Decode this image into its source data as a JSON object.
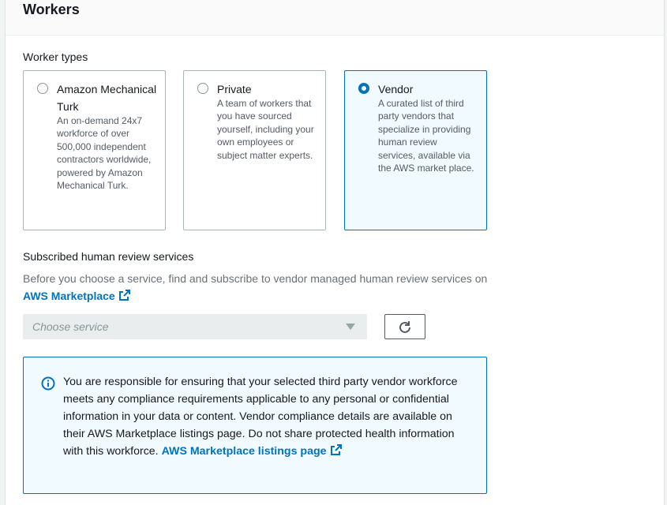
{
  "section": {
    "title": "Workers"
  },
  "worker_types": {
    "label": "Worker types",
    "selected": "vendor",
    "options": [
      {
        "id": "mturk",
        "title": "Amazon Mechanical Turk",
        "description": "An on-demand 24x7 workforce of over 500,000 independent contractors worldwide, powered by Amazon Mechanical Turk."
      },
      {
        "id": "private",
        "title": "Private",
        "description": "A team of workers that you have sourced yourself, including your own employees or subject matter experts."
      },
      {
        "id": "vendor",
        "title": "Vendor",
        "description": "A curated list of third party vendors that specialize in providing human review services, available via the AWS market place."
      }
    ]
  },
  "subscribed": {
    "label": "Subscribed human review services",
    "help_prefix": "Before you choose a service, find and subscribe to vendor managed human review services on",
    "help_link": "AWS Marketplace",
    "select_placeholder": "Choose service",
    "refresh_icon": "refresh-icon"
  },
  "alert": {
    "icon": "info-icon",
    "text": "You are responsible for ensuring that your selected third party vendor workforce meets any compliance requirements applicable to any personal or confidential information in your data or content. Vendor compliance details are available on their AWS Marketplace listings page. Do not share protected health information with this workforce.",
    "link": "AWS Marketplace listings page"
  },
  "colors": {
    "accent": "#0073bb",
    "selected_bg": "#f1faff",
    "text": "#16191f",
    "muted": "#687078"
  }
}
